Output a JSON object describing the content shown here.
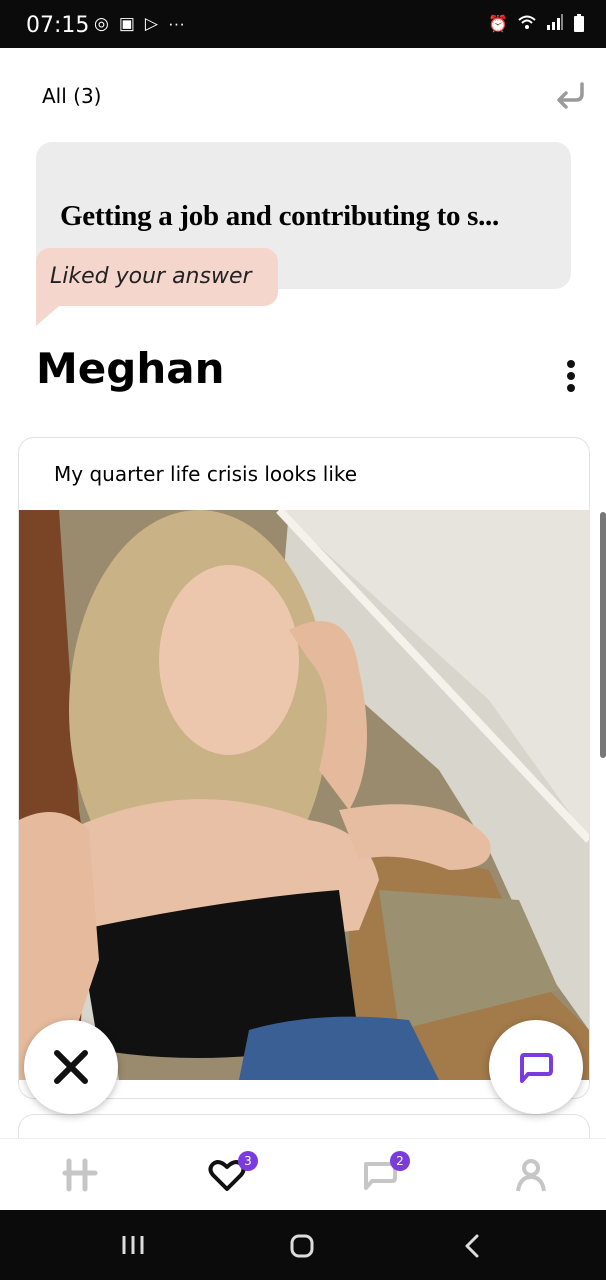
{
  "status_bar": {
    "time": "07:15",
    "left_icons": [
      "instagram-icon",
      "gallery-icon",
      "play-store-icon",
      "more-dots-icon"
    ],
    "right_icons": [
      "alarm-icon",
      "wifi-icon",
      "signal-icon",
      "battery-icon"
    ]
  },
  "header": {
    "filter_label": "All (3)",
    "back_icon": "return-arrow-icon"
  },
  "liked_card": {
    "answer_text": "Getting a job and contributing to s...",
    "liked_label": "Liked your answer",
    "bubble_color": "#f5d6cd"
  },
  "profile": {
    "name": "Meghan",
    "menu_icon": "vertical-dots-icon"
  },
  "prompt_card": {
    "prompt": "My quarter life crisis looks like"
  },
  "actions": {
    "reject_icon": "close-icon",
    "comment_icon": "chat-bubble-icon",
    "accent": "#7a3ddb"
  },
  "bottom_nav": {
    "items": [
      {
        "name": "home",
        "icon": "hinge-logo-icon",
        "badge": ""
      },
      {
        "name": "likes",
        "icon": "heart-icon",
        "badge": "3"
      },
      {
        "name": "matches",
        "icon": "chat-icon",
        "badge": "2"
      },
      {
        "name": "profile",
        "icon": "person-icon",
        "badge": ""
      }
    ]
  },
  "system_nav": [
    "recents-icon",
    "home-icon",
    "back-icon"
  ]
}
